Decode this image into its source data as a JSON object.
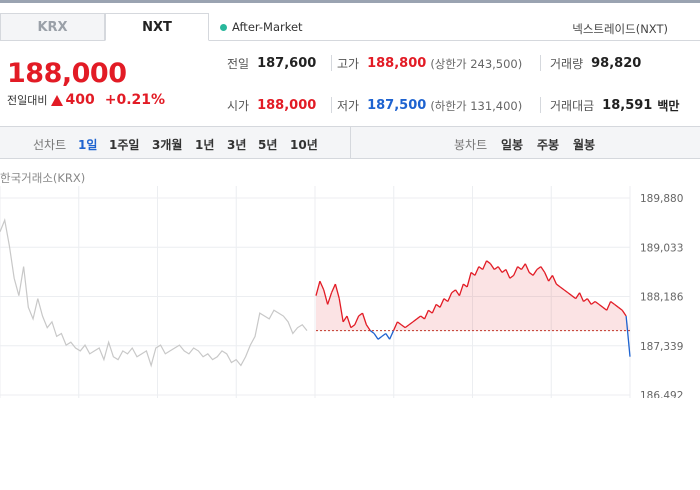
{
  "tabs": [
    {
      "label": "KRX",
      "active": false
    },
    {
      "label": "NXT",
      "active": true
    }
  ],
  "session_status": "After-Market",
  "market_label": "넥스트레이드(NXT)",
  "quote": {
    "price": "188,000",
    "change_label": "전일대비",
    "change": "400",
    "change_pct": "+0.21%"
  },
  "stats": {
    "prev_close": {
      "label": "전일",
      "value": "187,600"
    },
    "high": {
      "label": "고가",
      "value": "188,800",
      "sub": "(상한가 243,500)"
    },
    "volume": {
      "label": "거래량",
      "value": "98,820"
    },
    "open": {
      "label": "시가",
      "value": "188,000"
    },
    "low": {
      "label": "저가",
      "value": "187,500",
      "sub": "(하한가 131,400)"
    },
    "amount": {
      "label": "거래대금",
      "value": "18,591",
      "unit": "백만"
    }
  },
  "line_chart_periods": {
    "label": "선차트",
    "items": [
      "1일",
      "1주일",
      "3개월",
      "1년",
      "3년",
      "5년",
      "10년"
    ],
    "active": "1일"
  },
  "candle_chart_periods": {
    "label": "봉차트",
    "items": [
      "일봉",
      "주봉",
      "월봉"
    ]
  },
  "colors": {
    "up": "#e21b25",
    "down": "#1e63d0",
    "inactive": "#c8c8c8"
  },
  "chart_data": {
    "type": "line",
    "title": "한국거래소(KRX)",
    "y_ticks": [
      "189,880",
      "189,033",
      "188,186",
      "187,339",
      "186,492"
    ],
    "ylim": [
      186492,
      189880
    ],
    "reference_price": 187600,
    "series": [
      {
        "values": [
          189300,
          189500,
          189050,
          188500,
          188200,
          188700,
          188000,
          187800,
          188150,
          187850,
          187650,
          187750,
          187500,
          187550,
          187350,
          187400,
          187300,
          187250,
          187350,
          187200,
          187250,
          187300,
          187100,
          187400,
          187150,
          187100,
          187250,
          187200,
          187300,
          187150,
          187200,
          187250,
          187000,
          187300,
          187350,
          187200,
          187250,
          187300,
          187350,
          187250,
          187200,
          187300,
          187250,
          187150,
          187200,
          187100,
          187150,
          187250,
          187200,
          187050,
          187100,
          187000,
          187150,
          187350,
          187500,
          187900,
          187850,
          187800,
          187950,
          187900,
          187850,
          187750,
          187550,
          187650,
          187700,
          187600
        ]
      },
      {
        "values": [
          188200,
          188450,
          188300,
          188050,
          188250,
          188400,
          188150,
          187750,
          187850,
          187650,
          187700,
          187850,
          187900,
          187700,
          187600,
          187550,
          187450,
          187500,
          187550,
          187450,
          187600,
          187750,
          187700,
          187650,
          187700,
          187750,
          187800,
          187850,
          187800,
          187950,
          187900,
          188050,
          188000,
          188150,
          188100,
          188250,
          188300,
          188200,
          188400,
          188350,
          188600,
          188550,
          188700,
          188650,
          188800,
          188750,
          188650,
          188700,
          188600,
          188650,
          188500,
          188550,
          188700,
          188650,
          188750,
          188600,
          188550,
          188650,
          188700,
          188600,
          188450,
          188550,
          188400,
          188350,
          188300,
          188250,
          188200,
          188150,
          188250,
          188100,
          188150,
          188050,
          188100,
          188050,
          188000,
          187950,
          188100,
          188050,
          188000,
          187950,
          187850,
          187150
        ]
      }
    ]
  }
}
